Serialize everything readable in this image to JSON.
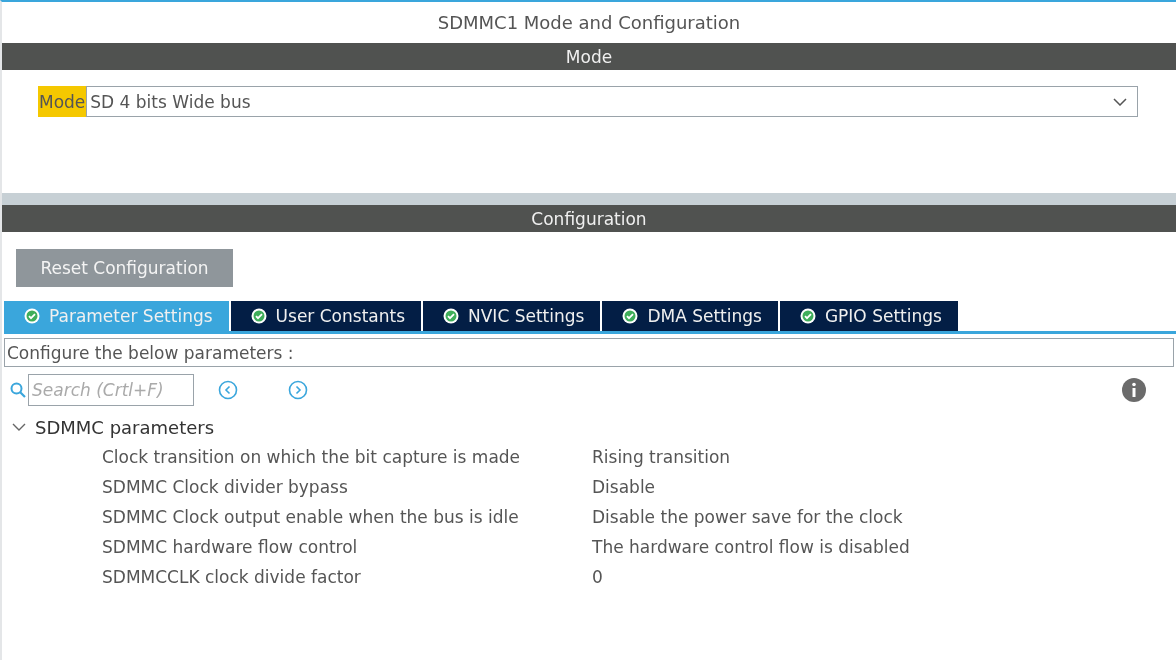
{
  "window": {
    "title": "SDMMC1 Mode and Configuration"
  },
  "mode_section": {
    "header": "Mode",
    "label": "Mode",
    "value": "SD 4 bits Wide bus"
  },
  "configuration_section": {
    "header": "Configuration",
    "reset_button": "Reset Configuration",
    "tabs": [
      {
        "label": "Parameter Settings",
        "selected": true
      },
      {
        "label": "User Constants",
        "selected": false
      },
      {
        "label": "NVIC Settings",
        "selected": false
      },
      {
        "label": "DMA Settings",
        "selected": false
      },
      {
        "label": "GPIO Settings",
        "selected": false
      }
    ],
    "description": "Configure the below parameters :",
    "search": {
      "placeholder": "Search (Crtl+F)"
    },
    "groups": [
      {
        "label": "SDMMC parameters",
        "expanded": true,
        "parameters": [
          {
            "name": "Clock transition on which the bit capture is made",
            "value": "Rising transition"
          },
          {
            "name": "SDMMC Clock divider bypass",
            "value": "Disable"
          },
          {
            "name": "SDMMC Clock output enable when the bus is idle",
            "value": "Disable the power save for the clock"
          },
          {
            "name": "SDMMC hardware flow control",
            "value": "The hardware control flow is disabled"
          },
          {
            "name": "SDMMCCLK clock divide factor",
            "value": "0"
          }
        ]
      }
    ]
  }
}
